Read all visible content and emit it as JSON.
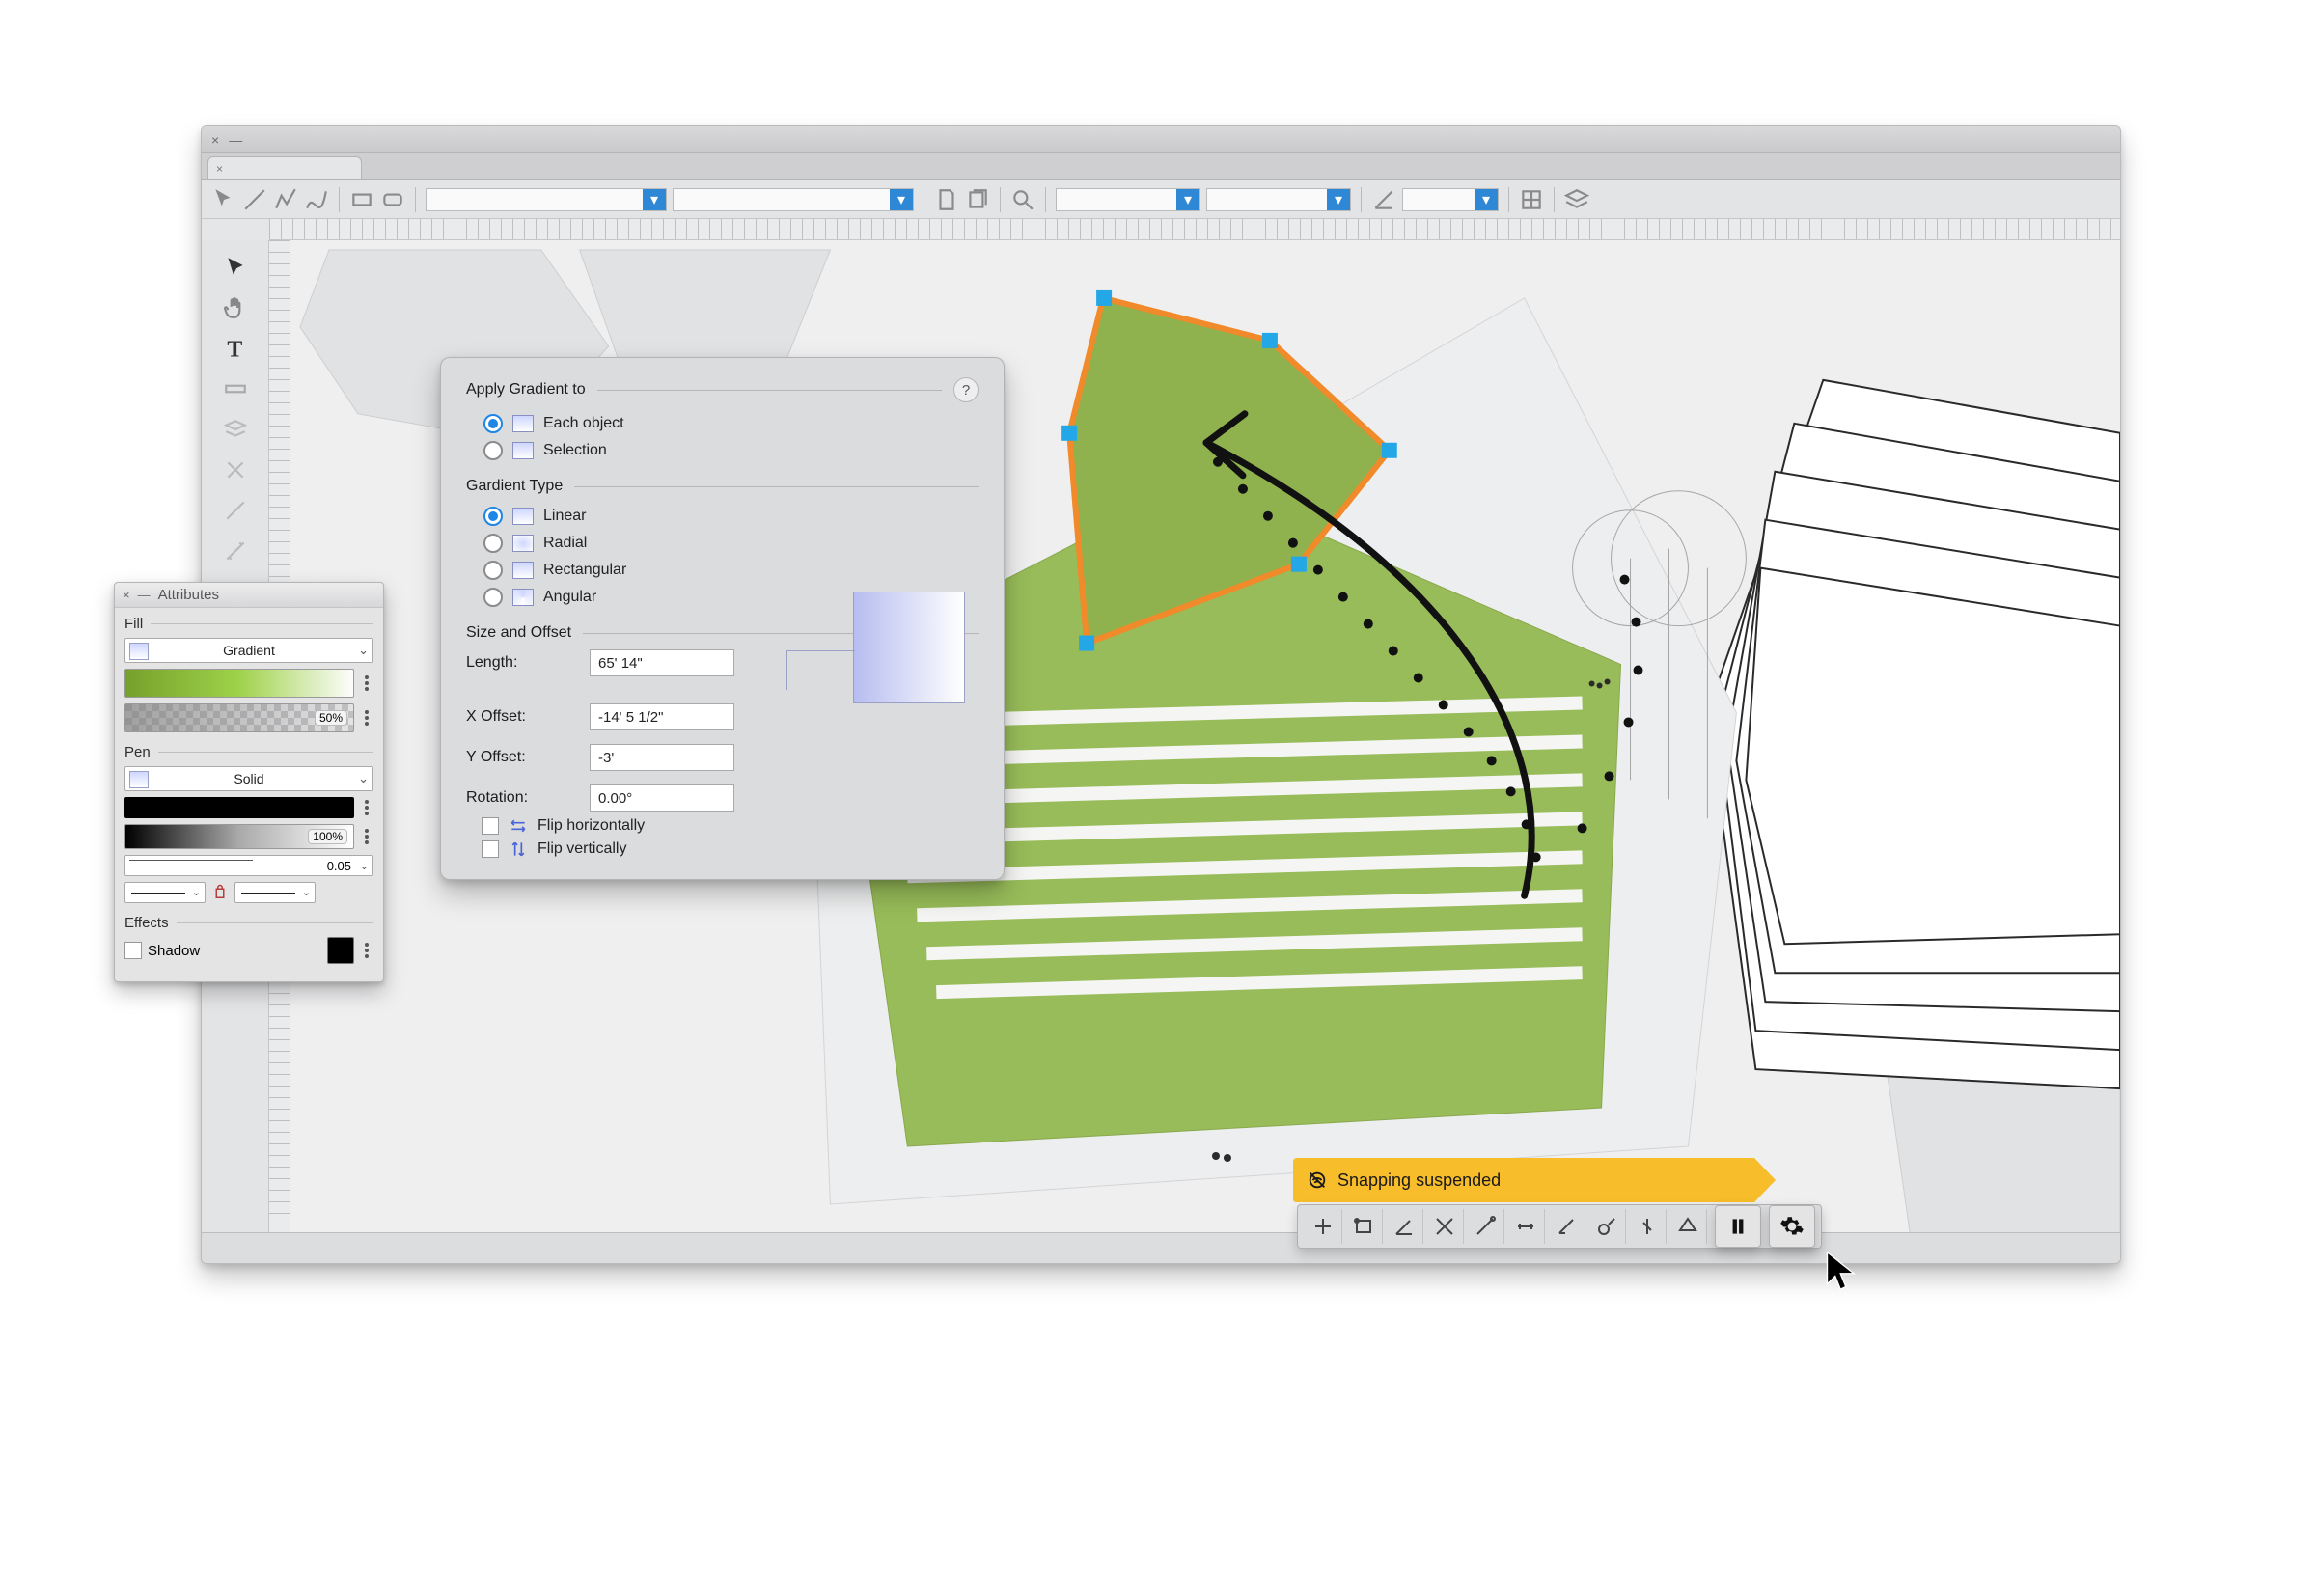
{
  "window": {
    "close_glyph": "×",
    "min_glyph": "—",
    "tab_close": "×"
  },
  "attributes": {
    "panel_title": "Attributes",
    "close_glyph": "×",
    "min_glyph": "—",
    "fill_label": "Fill",
    "fill_mode": "Gradient",
    "opacity_label": "50%",
    "pen_label": "Pen",
    "pen_mode": "Solid",
    "pen_opacity_label": "100%",
    "pen_width_value": "0.05",
    "effects_label": "Effects",
    "shadow_label": "Shadow"
  },
  "gradient": {
    "section_apply": "Apply Gradient to",
    "opt_each": "Each object",
    "opt_selection": "Selection",
    "section_type": "Gardient Type",
    "type_linear": "Linear",
    "type_radial": "Radial",
    "type_rect": "Rectangular",
    "type_angular": "Angular",
    "section_size": "Size and Offset",
    "length_label": "Length:",
    "length_value": "65' 14\"",
    "xoff_label": "X Offset:",
    "xoff_value": "-14' 5 1/2\"",
    "yoff_label": "Y Offset:",
    "yoff_value": "-3'",
    "rot_label": "Rotation:",
    "rot_value": "0.00°",
    "flip_h": "Flip horizontally",
    "flip_v": "Flip vertically",
    "help_glyph": "?"
  },
  "snap": {
    "tooltip": "Snapping suspended"
  }
}
